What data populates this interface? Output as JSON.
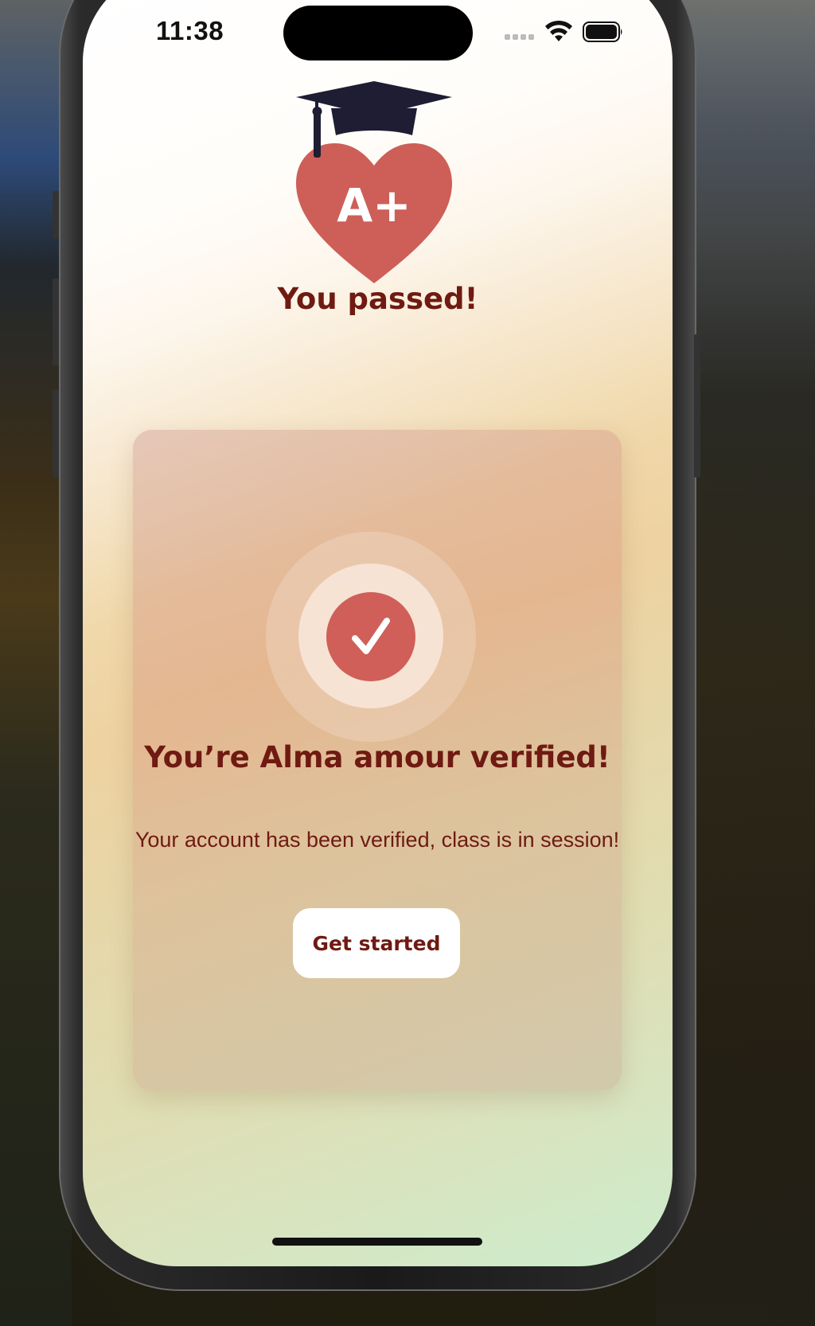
{
  "status_bar": {
    "time": "11:38",
    "icons": [
      "cellular-signal-icon",
      "wifi-icon",
      "battery-icon"
    ]
  },
  "header": {
    "icon": "graduation-cap-heart-a-plus-icon",
    "icon_letter": "A+",
    "title": "You passed!"
  },
  "card": {
    "icon": "checkmark-icon",
    "title": "You’re Alma amour verified!",
    "subtitle": "Your account has been verified, class is in session!",
    "button_label": "Get started"
  },
  "colors": {
    "brand_text": "#6f1a12",
    "accent_red": "#cf5f58",
    "cap_navy": "#1e1d33",
    "button_bg": "#ffffff"
  }
}
